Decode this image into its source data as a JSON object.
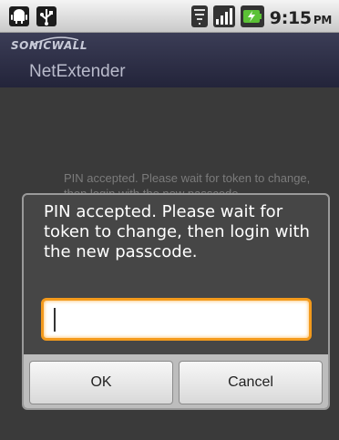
{
  "status_bar": {
    "time": "9:15",
    "ampm": "PM",
    "icons": [
      "android-icon",
      "usb-icon",
      "wifi-icon",
      "signal-icon",
      "battery-charging-icon"
    ]
  },
  "app": {
    "brand": "SONICWALL",
    "title": "NetExtender"
  },
  "background": {
    "text": "PIN accepted. Please wait for token to change, then login with the new passcode."
  },
  "dialog": {
    "message": "PIN accepted. Please wait for token to change, then login with the new passcode.",
    "input_value": "",
    "ok_label": "OK",
    "cancel_label": "Cancel"
  },
  "colors": {
    "accent_focus": "#f39a1c",
    "header_bg": "#2f3048",
    "dialog_bg": "#464646"
  }
}
